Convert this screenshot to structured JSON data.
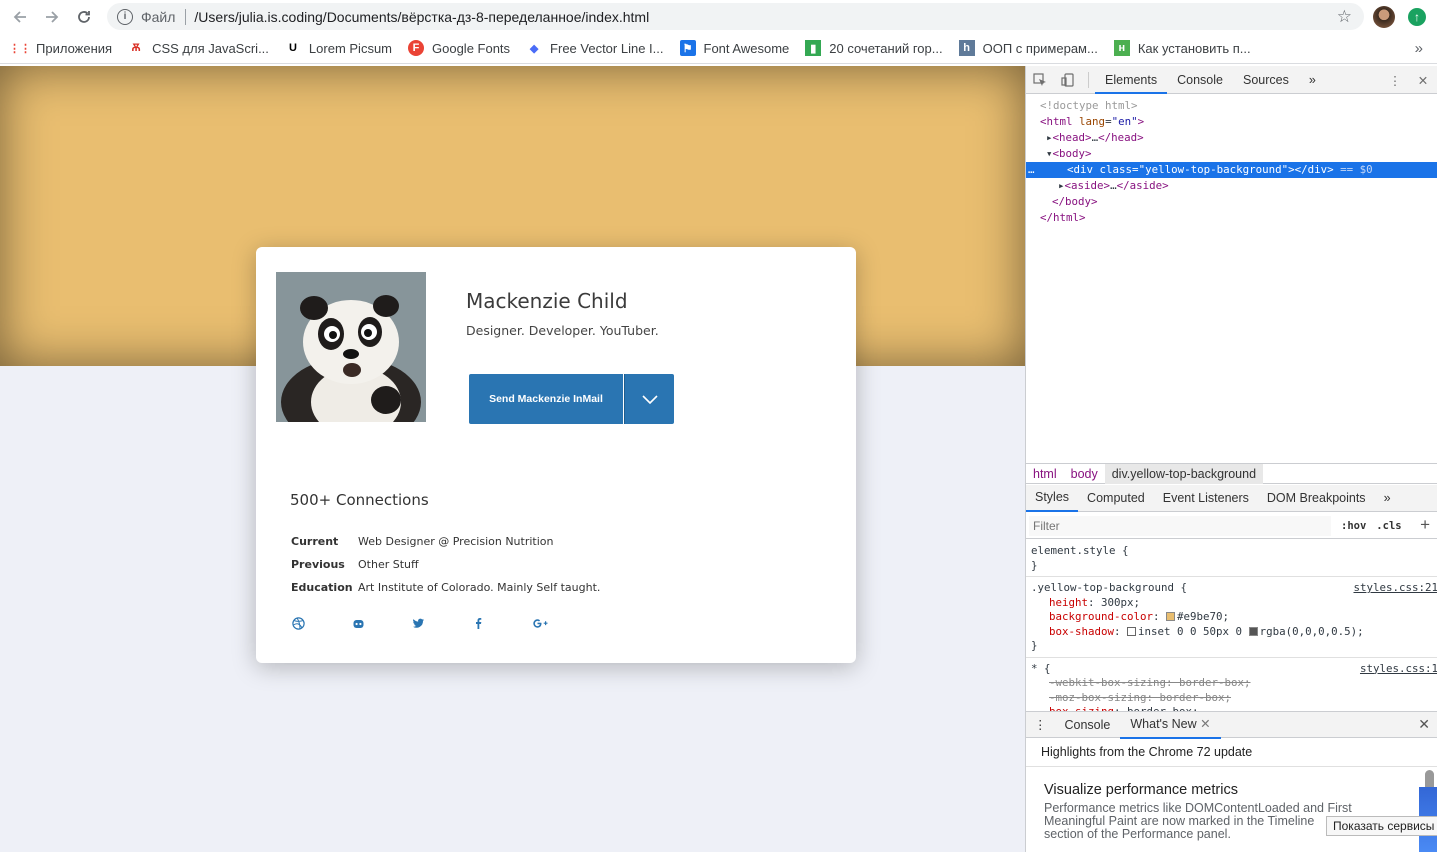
{
  "browser": {
    "scheme_label": "Файл",
    "url": "/Users/julia.is.coding/Documents/вёрстка-дз-8-переделанное/index.html"
  },
  "bookmarks": [
    {
      "label": "Приложения",
      "icon": "apps-grid-icon",
      "color": "#ea4335"
    },
    {
      "label": "CSS для JavaScri...",
      "icon": "tower-icon",
      "color": "#d93025"
    },
    {
      "label": "Lorem Picsum",
      "icon": "u-logo-icon",
      "color": "#000000"
    },
    {
      "label": "Google Fonts",
      "icon": "google-fonts-icon",
      "color": "#ea4335"
    },
    {
      "label": "Free Vector Line I...",
      "icon": "diamond-icon",
      "color": "#4a6cf7"
    },
    {
      "label": "Font Awesome",
      "icon": "flag-icon",
      "color": "#1a73e8"
    },
    {
      "label": "20 сочетаний гор...",
      "icon": "green-figure-icon",
      "color": "#34a853"
    },
    {
      "label": "ООП с примерам...",
      "icon": "h-logo-icon",
      "color": "#5f7a99"
    },
    {
      "label": "Как установить п...",
      "icon": "hk-logo-icon",
      "color": "#4caf50"
    }
  ],
  "profile": {
    "name": "Mackenzie Child",
    "tagline": "Designer. Developer. YouTuber.",
    "mail_button": "Send Mackenzie InMail",
    "connections": "500+ Connections",
    "info": [
      {
        "key": "Current",
        "value": "Web Designer @ Precision Nutrition"
      },
      {
        "key": "Previous",
        "value": "Other Stuff"
      },
      {
        "key": "Education",
        "value": "Art Institute of Colorado. Mainly Self taught."
      }
    ],
    "socials": [
      "dribbble-icon",
      "github-icon",
      "twitter-icon",
      "facebook-icon",
      "google-plus-icon"
    ],
    "colors": {
      "yellow": "#e9be70",
      "button": "#2a75b2",
      "page_bg": "#eef0f7"
    }
  },
  "devtools": {
    "tabs": [
      "Elements",
      "Console",
      "Sources"
    ],
    "dom": {
      "doctype": "<!doctype html>",
      "html_open": "html",
      "html_lang_attr": "lang",
      "html_lang_val": "\"en\"",
      "head": "head",
      "ellipsis": "…",
      "body": "body",
      "selected_div_class_attr": "class",
      "selected_div_class_val": "\"yellow-top-background\"",
      "selected_marker": "== $0",
      "aside": "aside"
    },
    "breadcrumbs": [
      "html",
      "body",
      "div.yellow-top-background"
    ],
    "sub_tabs": [
      "Styles",
      "Computed",
      "Event Listeners",
      "DOM Breakpoints"
    ],
    "filter_placeholder": "Filter",
    "hov": ":hov",
    "cls": ".cls",
    "rules": {
      "element_style": "element.style {",
      "close": "}",
      "yellow_selector": ".yellow-top-background {",
      "yellow_src": "styles.css:21",
      "height_name": "height",
      "height_value": "300px;",
      "bg_name": "background-color",
      "bg_value": "#e9be70;",
      "shadow_name": "box-shadow",
      "shadow_value": "inset 0 0 50px 0",
      "shadow_color": "rgba(0,0,0,0.5);",
      "star_selector": "* {",
      "star_src": "styles.css:1",
      "webkit_prop": "-webkit-box-sizing: border-box;",
      "moz_prop": "-moz-box-sizing: border-box;",
      "bs_name": "box-sizing",
      "bs_value": "border-box;"
    },
    "drawer_tabs": [
      "Console",
      "What's New"
    ],
    "highlights": "Highlights from the Chrome 72 update",
    "news_title": "Visualize performance metrics",
    "news_text": "Performance metrics like DOMContentLoaded and First Meaningful Paint are now marked in the Timeline section of the Performance panel.",
    "tooltip": "Показать сервисы"
  }
}
